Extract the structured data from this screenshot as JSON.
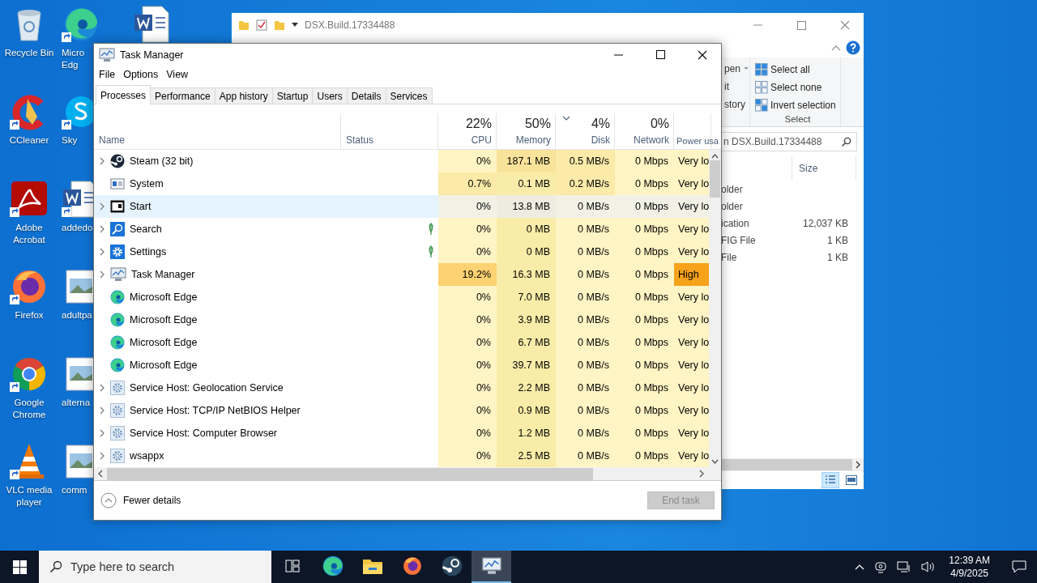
{
  "desktop": {
    "icons": [
      {
        "label": "Recycle Bin",
        "kind": "recycle",
        "shortcut": false
      },
      {
        "label": "CCleaner",
        "kind": "ccleaner",
        "shortcut": true
      },
      {
        "label": "Adobe\nAcrobat",
        "kind": "acrobat",
        "shortcut": true
      },
      {
        "label": "Firefox",
        "kind": "firefox",
        "shortcut": true
      },
      {
        "label": "Google\nChrome",
        "kind": "chrome",
        "shortcut": true
      },
      {
        "label": "VLC media\nplayer",
        "kind": "vlc",
        "shortcut": true
      },
      {
        "label": "Micro\nEdg",
        "kind": "edge",
        "shortcut": true
      },
      {
        "label": "Sky",
        "kind": "skype",
        "shortcut": true
      },
      {
        "label": "addedo",
        "kind": "word",
        "shortcut": true
      },
      {
        "label": "adultpa",
        "kind": "image",
        "shortcut": false
      },
      {
        "label": "alterna",
        "kind": "image",
        "shortcut": false
      },
      {
        "label": "comm",
        "kind": "image",
        "shortcut": false
      },
      {
        "kind": "word",
        "shortcut": false
      }
    ]
  },
  "explorer": {
    "title": "DSX.Build.17334488",
    "ribbon": {
      "fragments": [
        {
          "text": "pen",
          "dropdown": true
        },
        {
          "text": "it",
          "dropdown": false
        },
        {
          "text": "story",
          "dropdown": false
        }
      ],
      "select_group": {
        "items": [
          {
            "label": "Select all",
            "kind": "all"
          },
          {
            "label": "Select none",
            "kind": "none"
          },
          {
            "label": "Invert selection",
            "kind": "invert"
          }
        ],
        "label": "Select"
      }
    },
    "search": {
      "placeholder": "n DSX.Build.17334488"
    },
    "columns": [
      "Size"
    ],
    "rows": [
      {
        "type": "older"
      },
      {
        "type": "older"
      },
      {
        "type": "ication",
        "size": "12,037 KB"
      },
      {
        "type": "FIG File",
        "size": "1 KB"
      },
      {
        "type": "File",
        "size": "1 KB"
      }
    ]
  },
  "task_manager": {
    "title": "Task Manager",
    "menu": [
      "File",
      "Options",
      "View"
    ],
    "tabs": [
      {
        "label": "Processes",
        "selected": true
      },
      {
        "label": "Performance",
        "selected": false
      },
      {
        "label": "App history",
        "selected": false
      },
      {
        "label": "Startup",
        "selected": false
      },
      {
        "label": "Users",
        "selected": false
      },
      {
        "label": "Details",
        "selected": false
      },
      {
        "label": "Services",
        "selected": false
      }
    ],
    "name_header": "Name",
    "status_header": "Status",
    "columns": [
      {
        "label": "CPU",
        "total": "22%",
        "sorted": false
      },
      {
        "label": "Memory",
        "total": "50%",
        "sorted": false
      },
      {
        "label": "Disk",
        "total": "4%",
        "sorted": true
      },
      {
        "label": "Network",
        "total": "0%",
        "sorted": false
      },
      {
        "label": "Power usa"
      }
    ],
    "rows": [
      {
        "name": "Steam (32 bit)",
        "kind": "steam",
        "expandable": true,
        "selected": false,
        "eco": false,
        "cells": [
          {
            "text": "0%",
            "color": "#fff4c4"
          },
          {
            "text": "187.1 MB",
            "color": "#f9e39a"
          },
          {
            "text": "0.5 MB/s",
            "color": "#fbeaa8"
          },
          {
            "text": "0 Mbps",
            "color": "#fff4c4"
          },
          {
            "text": "Very lo",
            "color": "#fff4c4"
          }
        ]
      },
      {
        "name": "System",
        "kind": "system",
        "expandable": false,
        "selected": false,
        "eco": false,
        "cells": [
          {
            "text": "0.7%",
            "color": "#fbeaa8"
          },
          {
            "text": "0.1 MB",
            "color": "#f9eca8"
          },
          {
            "text": "0.2 MB/s",
            "color": "#fbeaa8"
          },
          {
            "text": "0 Mbps",
            "color": "#fff4c4"
          },
          {
            "text": "Very lo",
            "color": "#fff4c4"
          }
        ]
      },
      {
        "name": "Start",
        "kind": "start",
        "expandable": true,
        "selected": true,
        "eco": false,
        "cells": [
          {
            "text": "0%",
            "color": "#f1f1e6"
          },
          {
            "text": "13.8 MB",
            "color": "#eeece0"
          },
          {
            "text": "0 MB/s",
            "color": "#f1f1e6"
          },
          {
            "text": "0 Mbps",
            "color": "#f1f1e6"
          },
          {
            "text": "Very lo",
            "color": "#f1f1e6"
          }
        ]
      },
      {
        "name": "Search",
        "kind": "search",
        "expandable": true,
        "selected": false,
        "eco": true,
        "cells": [
          {
            "text": "0%",
            "color": "#fff4c4"
          },
          {
            "text": "0 MB",
            "color": "#f9eca8"
          },
          {
            "text": "0 MB/s",
            "color": "#fff4c4"
          },
          {
            "text": "0 Mbps",
            "color": "#fff4c4"
          },
          {
            "text": "Very lo",
            "color": "#fff4c4"
          }
        ]
      },
      {
        "name": "Settings",
        "kind": "settings",
        "expandable": true,
        "selected": false,
        "eco": true,
        "cells": [
          {
            "text": "0%",
            "color": "#fff4c4"
          },
          {
            "text": "0 MB",
            "color": "#f9eca8"
          },
          {
            "text": "0 MB/s",
            "color": "#fff4c4"
          },
          {
            "text": "0 Mbps",
            "color": "#fff4c4"
          },
          {
            "text": "Very lo",
            "color": "#fff4c4"
          }
        ]
      },
      {
        "name": "Task Manager",
        "kind": "taskmgr",
        "expandable": true,
        "selected": false,
        "eco": false,
        "cells": [
          {
            "text": "19.2%",
            "color": "#fdd272"
          },
          {
            "text": "16.3 MB",
            "color": "#f9eca8"
          },
          {
            "text": "0 MB/s",
            "color": "#fff4c4"
          },
          {
            "text": "0 Mbps",
            "color": "#fff4c4"
          },
          {
            "text": "High",
            "color": "#f7a21b"
          }
        ]
      },
      {
        "name": "Microsoft Edge",
        "kind": "edge",
        "expandable": false,
        "selected": false,
        "eco": false,
        "cells": [
          {
            "text": "0%",
            "color": "#fff4c4"
          },
          {
            "text": "7.0 MB",
            "color": "#f9eca8"
          },
          {
            "text": "0 MB/s",
            "color": "#fff4c4"
          },
          {
            "text": "0 Mbps",
            "color": "#fff4c4"
          },
          {
            "text": "Very lo",
            "color": "#fff4c4"
          }
        ]
      },
      {
        "name": "Microsoft Edge",
        "kind": "edge",
        "expandable": false,
        "selected": false,
        "eco": false,
        "cells": [
          {
            "text": "0%",
            "color": "#fff4c4"
          },
          {
            "text": "3.9 MB",
            "color": "#f9eca8"
          },
          {
            "text": "0 MB/s",
            "color": "#fff4c4"
          },
          {
            "text": "0 Mbps",
            "color": "#fff4c4"
          },
          {
            "text": "Very lo",
            "color": "#fff4c4"
          }
        ]
      },
      {
        "name": "Microsoft Edge",
        "kind": "edge",
        "expandable": false,
        "selected": false,
        "eco": false,
        "cells": [
          {
            "text": "0%",
            "color": "#fff4c4"
          },
          {
            "text": "6.7 MB",
            "color": "#f9eca8"
          },
          {
            "text": "0 MB/s",
            "color": "#fff4c4"
          },
          {
            "text": "0 Mbps",
            "color": "#fff4c4"
          },
          {
            "text": "Very lo",
            "color": "#fff4c4"
          }
        ]
      },
      {
        "name": "Microsoft Edge",
        "kind": "edge",
        "expandable": false,
        "selected": false,
        "eco": false,
        "cells": [
          {
            "text": "0%",
            "color": "#fff4c4"
          },
          {
            "text": "39.7 MB",
            "color": "#f9eca8"
          },
          {
            "text": "0 MB/s",
            "color": "#fff4c4"
          },
          {
            "text": "0 Mbps",
            "color": "#fff4c4"
          },
          {
            "text": "Very lo",
            "color": "#fff4c4"
          }
        ]
      },
      {
        "name": "Service Host: Geolocation Service",
        "kind": "gear",
        "expandable": true,
        "selected": false,
        "eco": false,
        "cells": [
          {
            "text": "0%",
            "color": "#fff4c4"
          },
          {
            "text": "2.2 MB",
            "color": "#f9eca8"
          },
          {
            "text": "0 MB/s",
            "color": "#fff4c4"
          },
          {
            "text": "0 Mbps",
            "color": "#fff4c4"
          },
          {
            "text": "Very lo",
            "color": "#fff4c4"
          }
        ]
      },
      {
        "name": "Service Host: TCP/IP NetBIOS Helper",
        "kind": "gear",
        "expandable": true,
        "selected": false,
        "eco": false,
        "cells": [
          {
            "text": "0%",
            "color": "#fff4c4"
          },
          {
            "text": "0.9 MB",
            "color": "#f9eca8"
          },
          {
            "text": "0 MB/s",
            "color": "#fff4c4"
          },
          {
            "text": "0 Mbps",
            "color": "#fff4c4"
          },
          {
            "text": "Very lo",
            "color": "#fff4c4"
          }
        ]
      },
      {
        "name": "Service Host: Computer Browser",
        "kind": "gear",
        "expandable": true,
        "selected": false,
        "eco": false,
        "cells": [
          {
            "text": "0%",
            "color": "#fff4c4"
          },
          {
            "text": "1.2 MB",
            "color": "#f9eca8"
          },
          {
            "text": "0 MB/s",
            "color": "#fff4c4"
          },
          {
            "text": "0 Mbps",
            "color": "#fff4c4"
          },
          {
            "text": "Very lo",
            "color": "#fff4c4"
          }
        ]
      },
      {
        "name": "wsappx",
        "kind": "gear",
        "expandable": true,
        "selected": false,
        "eco": false,
        "cells": [
          {
            "text": "0%",
            "color": "#fff4c4"
          },
          {
            "text": "2.5 MB",
            "color": "#f9eca8"
          },
          {
            "text": "0 MB/s",
            "color": "#fff4c4"
          },
          {
            "text": "0 Mbps",
            "color": "#fff4c4"
          },
          {
            "text": "Very lo",
            "color": "#fff4c4"
          }
        ]
      }
    ],
    "footer": {
      "toggle": "Fewer details",
      "end_task": {
        "label": "End task",
        "disabled": true
      }
    }
  },
  "taskbar": {
    "search": {
      "placeholder": "Type here to search"
    },
    "apps": [
      {
        "kind": "taskview",
        "active": false
      },
      {
        "kind": "edge",
        "active": false
      },
      {
        "kind": "explorer",
        "active": false
      },
      {
        "kind": "firefox",
        "active": false
      },
      {
        "kind": "steam",
        "active": false
      },
      {
        "kind": "taskmgr",
        "active": true
      }
    ],
    "clock": {
      "time": "12:39 AM",
      "date": "4/9/2025"
    }
  }
}
